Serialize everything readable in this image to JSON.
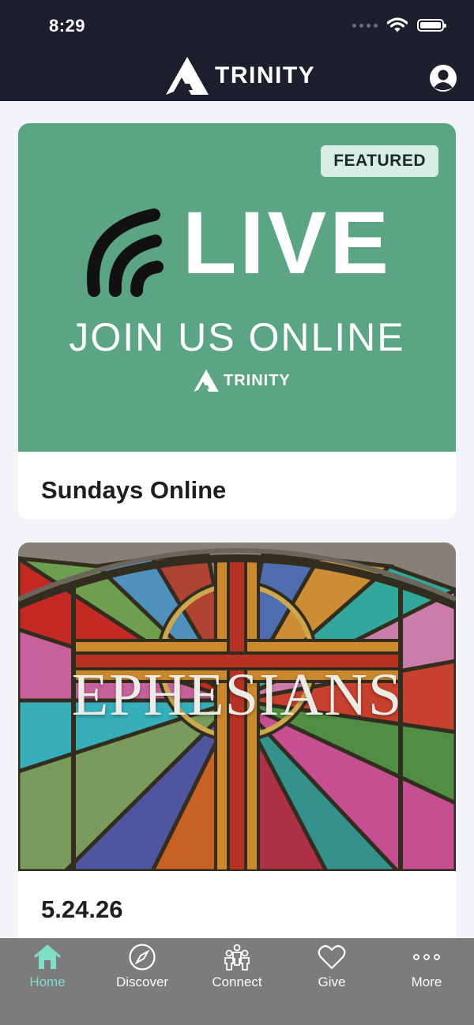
{
  "status_bar": {
    "time": "8:29"
  },
  "header": {
    "brand_name": "TRINITY"
  },
  "cards": [
    {
      "badge": "FEATURED",
      "image": {
        "headline": "LIVE",
        "subline": "JOIN US ONLINE",
        "brand": "TRINITY",
        "background": "#5ba584"
      },
      "title": "Sundays Online"
    },
    {
      "image": {
        "headline": "EPHESIANS"
      },
      "title": "5.24.26"
    }
  ],
  "tabs": [
    {
      "label": "Home",
      "icon": "home-icon",
      "active": true
    },
    {
      "label": "Discover",
      "icon": "compass-icon",
      "active": false
    },
    {
      "label": "Connect",
      "icon": "people-icon",
      "active": false
    },
    {
      "label": "Give",
      "icon": "heart-icon",
      "active": false
    },
    {
      "label": "More",
      "icon": "more-icon",
      "active": false
    }
  ],
  "colors": {
    "header_bg": "#1e1f2c",
    "tabbar_bg": "#7c7c7c",
    "active_tab": "#7fe0c6",
    "live_green": "#5ba584"
  }
}
